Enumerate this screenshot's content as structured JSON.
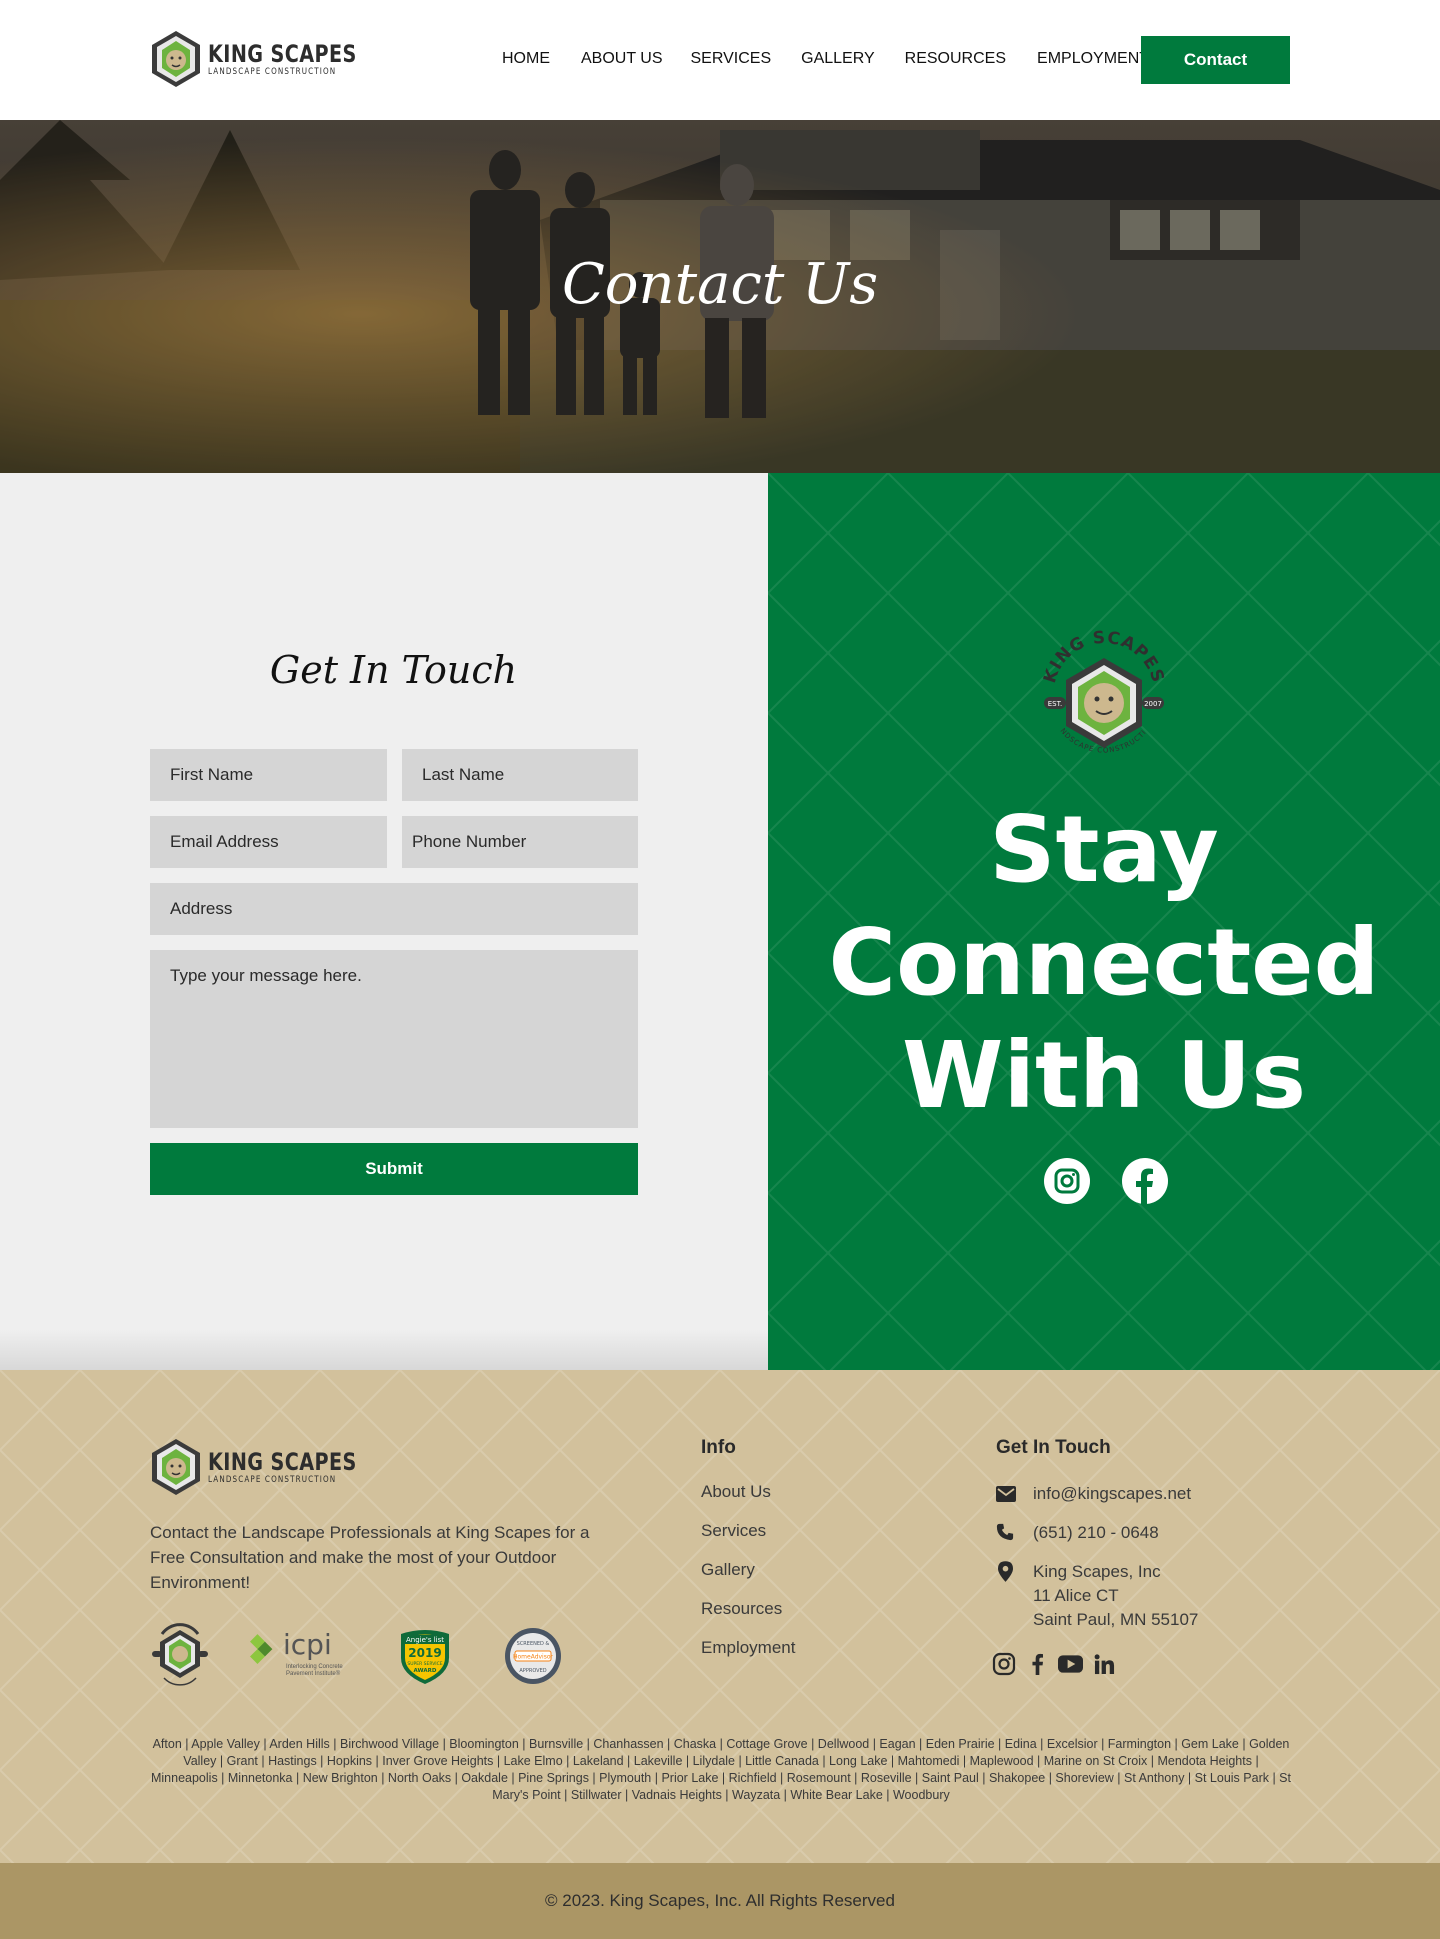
{
  "brand": {
    "name": "KING SCAPES",
    "tagline": "LANDSCAPE CONSTRUCTION",
    "badge_top": "KING SCAPES",
    "badge_est": "EST.",
    "badge_year": "2007",
    "badge_bottom": "LANDSCAPE CONSTRUCTION"
  },
  "nav": {
    "items": [
      "HOME",
      "ABOUT US",
      "SERVICES",
      "GALLERY",
      "RESOURCES",
      "EMPLOYMENT"
    ],
    "contact_label": "Contact"
  },
  "hero": {
    "title": "Contact Us"
  },
  "form": {
    "heading": "Get In Touch",
    "first_name": "First Name",
    "last_name": "Last Name",
    "email": "Email Address",
    "phone": "Phone Number",
    "address": "Address",
    "message": "Type your message here.",
    "submit": "Submit"
  },
  "connect": {
    "line1": "Stay",
    "line2": "Connected",
    "line3": "With Us",
    "social_icons": [
      "instagram-icon",
      "facebook-icon"
    ]
  },
  "footer": {
    "description": "Contact the Landscape Professionals at King Scapes for a Free Consultation and make the most of your Outdoor Environment!",
    "badges": {
      "icpi_name": "icpi",
      "icpi_sub1": "Interlocking Concrete",
      "icpi_sub2": "Pavement Institute®",
      "angie_top": "Angie's list",
      "angie_year": "2019",
      "angie_mid": "SUPER SERVICE",
      "angie_bottom": "AWARD",
      "homeadvisor_top": "SCREENED &",
      "homeadvisor_name": "HomeAdvisor",
      "homeadvisor_bottom": "APPROVED"
    },
    "info_heading": "Info",
    "info_links": [
      "About Us",
      "Services",
      "Gallery",
      "Resources",
      "Employment"
    ],
    "touch_heading": "Get In Touch",
    "email": "info@kingscapes.net",
    "phone": "(651) 210 - 0648",
    "address_line1": "King Scapes, Inc",
    "address_line2": "11 Alice CT",
    "address_line3": "Saint Paul, MN 55107",
    "social_icons": [
      "instagram-icon",
      "facebook-icon",
      "youtube-icon",
      "linkedin-icon"
    ],
    "cities": "Afton | Apple Valley | Arden Hills | Birchwood Village | Bloomington | Burnsville | Chanhassen | Chaska | Cottage Grove | Dellwood | Eagan | Eden Prairie | Edina | Excelsior | Farmington | Gem Lake | Golden Valley | Grant | Hastings | Hopkins | Inver Grove Heights | Lake Elmo | Lakeland | Lakeville | Lilydale | Little Canada | Long Lake | Mahtomedi | Maplewood | Marine on St Croix | Mendota Heights | Minneapolis | Minnetonka | New Brighton | North Oaks | Oakdale | Pine Springs | Plymouth | Prior Lake | Richfield | Rosemount | Roseville | Saint Paul | Shakopee | Shoreview | St Anthony | St Louis Park | St Mary's Point | Stillwater | Vadnais Heights | Wayzata | White Bear Lake | Woodbury",
    "copyright": "© 2023. King Scapes, Inc. All Rights Reserved"
  },
  "colors": {
    "brand_green": "#007a3d",
    "footer_tan": "#d2c19c",
    "copyright_bar": "#ab9665",
    "form_bg": "#efefef",
    "field_bg": "#d5d5d5"
  }
}
